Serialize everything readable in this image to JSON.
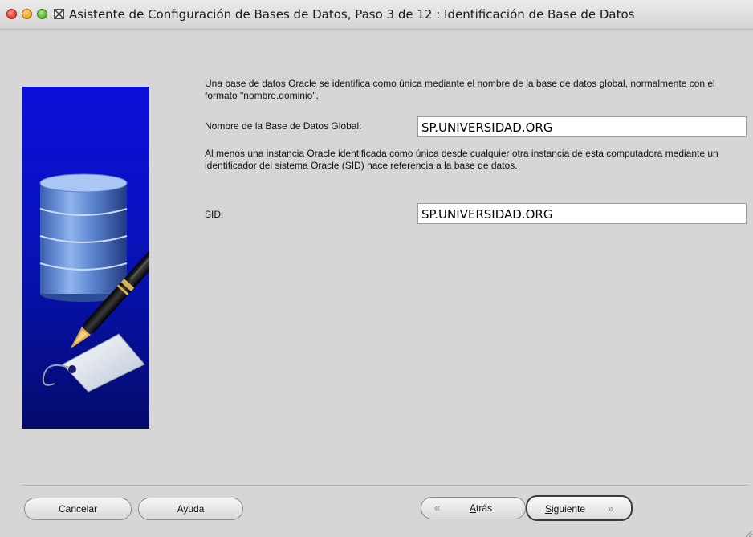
{
  "window": {
    "title": "Asistente de Configuración de Bases de Datos, Paso 3 de 12 : Identificación de Base de Datos"
  },
  "content": {
    "intro_text": "Una base de datos Oracle se identifica como única mediante el nombre de la base de datos global, normalmente con el formato \"nombre.dominio\".",
    "global_db_label": "Nombre de la Base de Datos Global:",
    "global_db_value": "SP.UNIVERSIDAD.ORG",
    "sid_text": "Al menos una instancia Oracle identificada como única desde cualquier otra instancia de esta computadora mediante un identificador del sistema Oracle (SID) hace referencia a la base de datos.",
    "sid_label": "SID:",
    "sid_value": "SP.UNIVERSIDAD.ORG"
  },
  "buttons": {
    "cancel": "Cancelar",
    "help": "Ayuda",
    "back_mnemonic": "A",
    "back_rest": "trás",
    "next_mnemonic": "S",
    "next_rest": "iguiente"
  },
  "icons": {
    "back_arrow": "«",
    "next_arrow": "»"
  },
  "colors": {
    "side_graphic": "#0a0fd8",
    "window_bg": "#d6d6d6"
  }
}
